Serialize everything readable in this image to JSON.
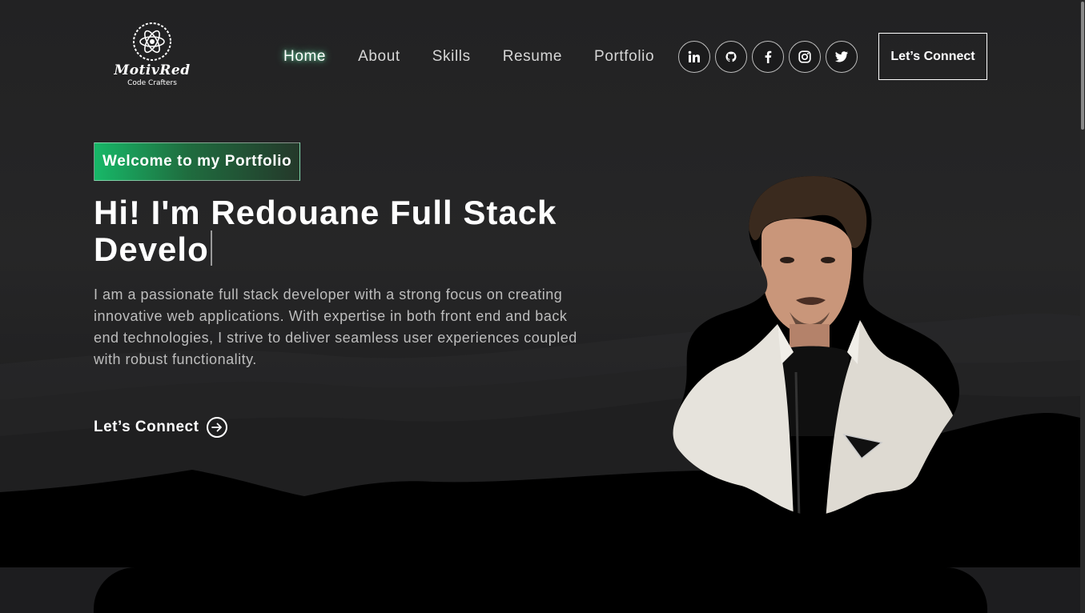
{
  "brand": {
    "name": "MotivRed",
    "tagline": "Code Crafters"
  },
  "nav": {
    "items": [
      {
        "label": "Home",
        "active": true
      },
      {
        "label": "About"
      },
      {
        "label": "Skills"
      },
      {
        "label": "Resume"
      },
      {
        "label": "Portfolio"
      }
    ]
  },
  "socials": [
    {
      "icon": "linkedin-icon"
    },
    {
      "icon": "github-icon"
    },
    {
      "icon": "facebook-icon"
    },
    {
      "icon": "instagram-icon"
    },
    {
      "icon": "twitter-icon"
    }
  ],
  "header_cta": {
    "label": "Let’s Connect"
  },
  "hero": {
    "tagline": "Welcome to my Portfolio",
    "headline": "Hi! I'm Redouane Full Stack Develo",
    "bio": "I am a passionate full stack developer with a strong focus on creating innovative web applications. With expertise in both front end and back end technologies, I strive to deliver seamless user experiences coupled with robust functionality.",
    "cta_label": "Let’s Connect"
  },
  "colors": {
    "accent_green": "#17b868",
    "background": "#1d1d1f",
    "nav_glow": "#78ffbe"
  }
}
